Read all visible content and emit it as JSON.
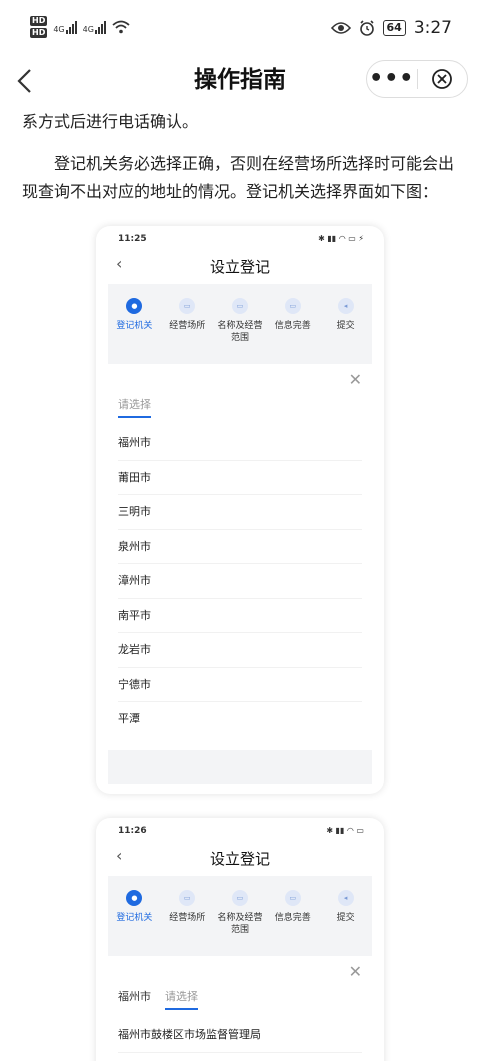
{
  "status": {
    "hd1": "HD",
    "hd2": "HD",
    "net1": "4G",
    "net2": "4G",
    "battery": "64",
    "time": "3:27"
  },
  "nav": {
    "title": "操作指南",
    "more_label": "•••"
  },
  "content": {
    "para1": "系方式后进行电话确认。",
    "para2": "登记机关务必选择正确，否则在经营场所选择时可能会出现查询不出对应的地址的情况。登记机关选择界面如下图："
  },
  "shot1": {
    "time": "11:25",
    "title": "设立登记",
    "steps": [
      "登记机关",
      "经营场所",
      "名称及经营范围",
      "信息完善",
      "提交"
    ],
    "tabs": [
      "请选择"
    ],
    "items": [
      "福州市",
      "莆田市",
      "三明市",
      "泉州市",
      "漳州市",
      "南平市",
      "龙岩市",
      "宁德市",
      "平潭"
    ]
  },
  "shot2": {
    "time": "11:26",
    "title": "设立登记",
    "steps": [
      "登记机关",
      "经营场所",
      "名称及经营范围",
      "信息完善",
      "提交"
    ],
    "tabs": [
      "福州市",
      "请选择"
    ],
    "items": [
      "福州市鼓楼区市场监督管理局"
    ]
  },
  "colors": {
    "accent": "#1f6ae0"
  }
}
